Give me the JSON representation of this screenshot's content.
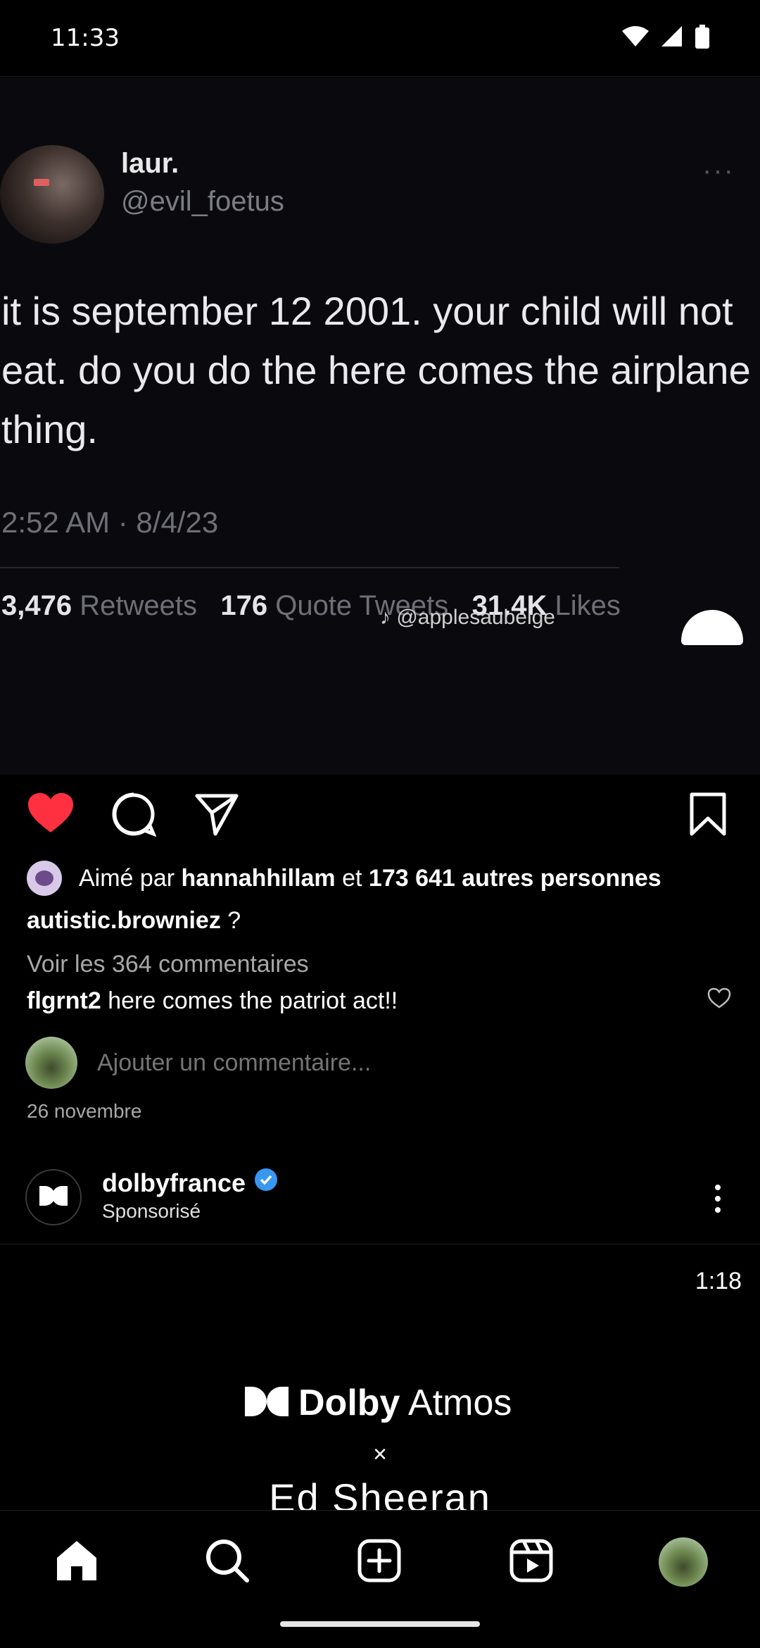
{
  "status_bar": {
    "time": "11:33"
  },
  "post": {
    "tweet": {
      "name": "laur.",
      "handle": "@evil_foetus",
      "more": "···",
      "text": "it is september 12 2001. your child will not eat. do you do the here comes the airplane thing.",
      "date": "2:52 AM · 8/4/23",
      "retweets_count": "3,476",
      "retweets_label": "Retweets",
      "quotes_count": "176",
      "quotes_label": "Quote Tweets",
      "likes_count": "31.4K",
      "likes_label": "Likes",
      "watermark": "@applesaubeige"
    },
    "likes": {
      "prefix": "Aimé par",
      "user": "hannahhillam",
      "connector": "et",
      "others": "173 641 autres personnes"
    },
    "caption": {
      "user": "autistic.browniez",
      "text": "?"
    },
    "view_comments": "Voir les 364 commentaires",
    "top_comment": {
      "user": "flgrnt2",
      "text": "here comes the patriot act!!"
    },
    "add_comment_placeholder": "Ajouter un commentaire...",
    "date": "26 novembre"
  },
  "sponsored": {
    "account": "dolbyfrance",
    "label": "Sponsorisé",
    "video_time": "1:18",
    "brand_bold": "Dolby",
    "brand_light": "Atmos",
    "times": "×",
    "artist": "Ed Sheeran"
  },
  "colors": {
    "like_red": "#ff3040",
    "verified_blue": "#3897f0",
    "muted_text": "#a8a8a8"
  },
  "icons": {
    "action_bar": [
      "heart-filled-icon",
      "comment-icon",
      "share-icon",
      "bookmark-icon"
    ],
    "nav": [
      "home-icon",
      "search-icon",
      "create-icon",
      "reels-icon",
      "profile-avatar"
    ]
  }
}
